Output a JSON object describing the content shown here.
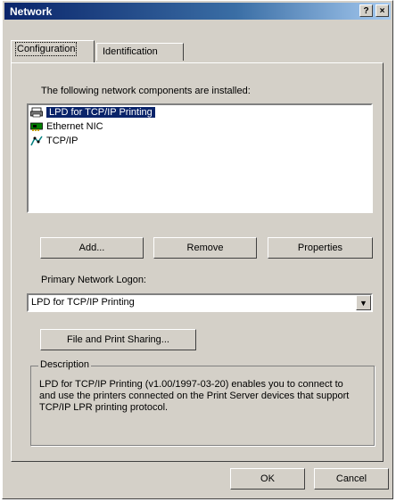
{
  "window": {
    "title": "Network",
    "help_label": "?",
    "close_label": "×"
  },
  "tabs": [
    {
      "label": "Configuration"
    },
    {
      "label": "Identification"
    }
  ],
  "config": {
    "installed_label": "The following network components are installed:",
    "components": [
      {
        "label": "LPD for TCP/IP Printing",
        "icon": "printer-service-icon"
      },
      {
        "label": "Ethernet NIC",
        "icon": "network-adapter-icon"
      },
      {
        "label": "TCP/IP",
        "icon": "protocol-icon"
      }
    ],
    "add_label": "Add...",
    "remove_label": "Remove",
    "properties_label": "Properties",
    "primary_logon_label": "Primary Network Logon:",
    "primary_logon_value": "LPD for TCP/IP Printing",
    "file_print_label": "File and Print Sharing...",
    "description_legend": "Description",
    "description_text": "LPD for TCP/IP Printing (v1.00/1997-03-20) enables you to connect to and use the printers connected on the Print Server devices that support TCP/IP LPR printing protocol."
  },
  "footer": {
    "ok_label": "OK",
    "cancel_label": "Cancel"
  }
}
